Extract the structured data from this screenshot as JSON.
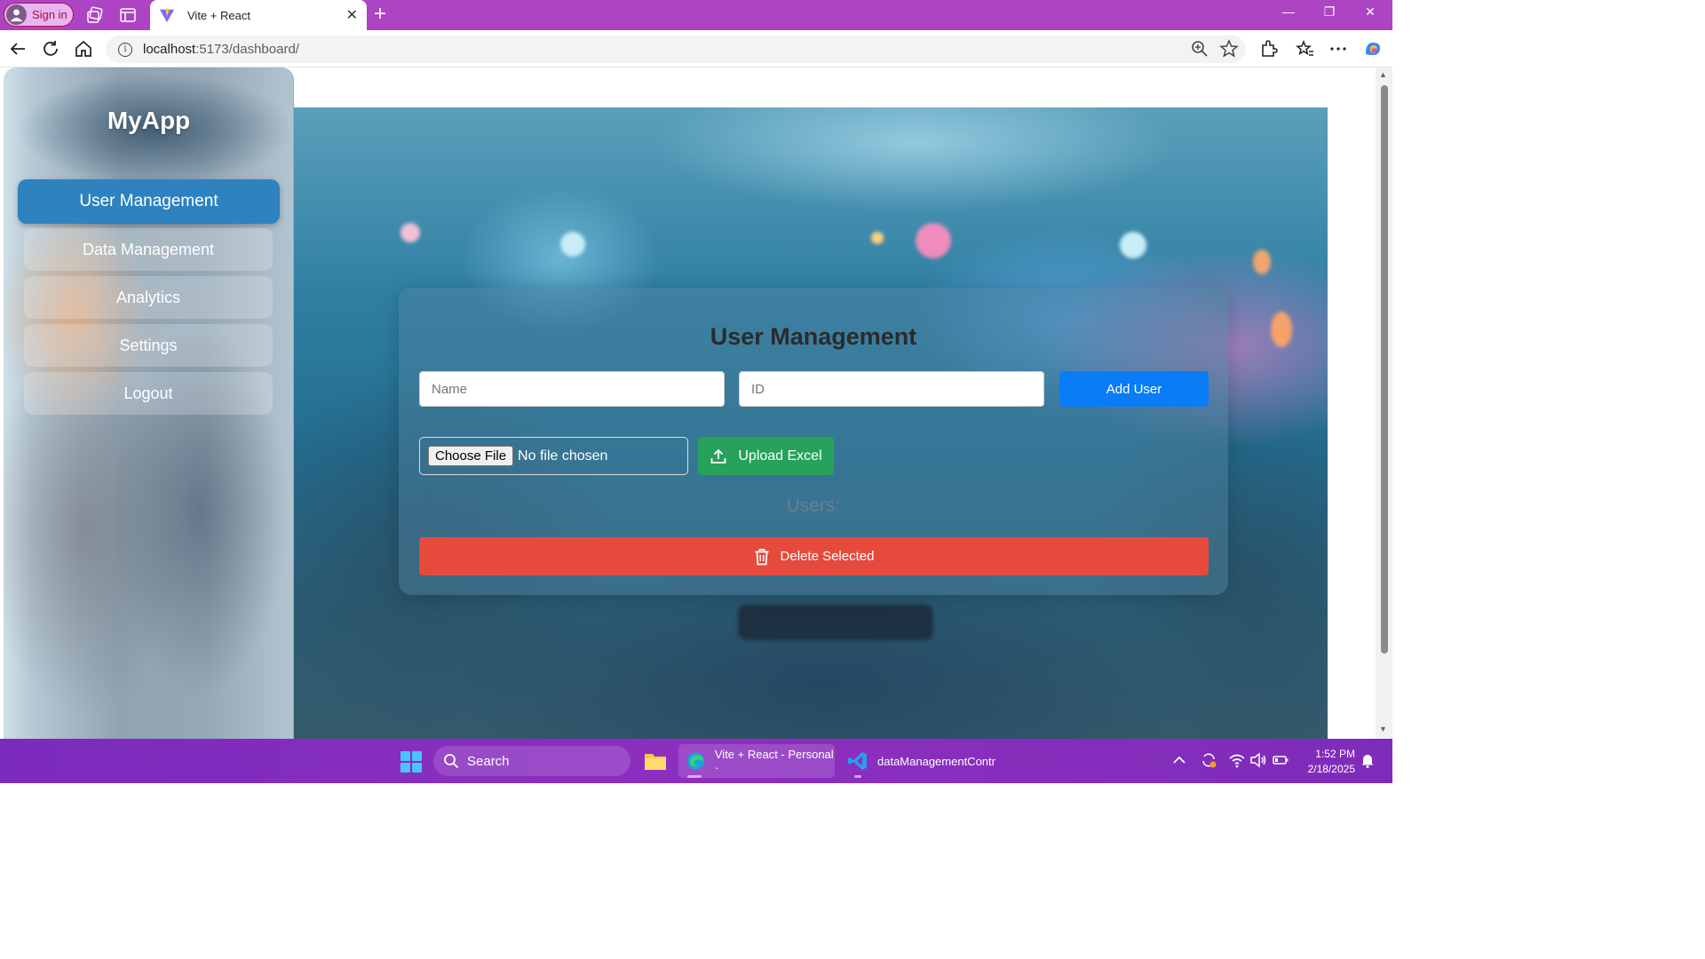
{
  "browser": {
    "signin_label": "Sign in",
    "tab_title": "Vite + React",
    "new_tab": "+",
    "url_host": "localhost",
    "url_path": ":5173/dashboard/"
  },
  "sidebar": {
    "brand": "MyApp",
    "items": [
      {
        "label": "User Management",
        "active": true
      },
      {
        "label": "Data Management",
        "active": false
      },
      {
        "label": "Analytics",
        "active": false
      },
      {
        "label": "Settings",
        "active": false
      },
      {
        "label": "Logout",
        "active": false
      }
    ]
  },
  "main": {
    "title": "User Management",
    "name_placeholder": "Name",
    "id_placeholder": "ID",
    "add_button": "Add User",
    "choose_file": "Choose File",
    "no_file": "No file chosen",
    "upload_button": "Upload Excel",
    "users_label": "Users:",
    "delete_button": "Delete Selected"
  },
  "colors": {
    "tab_bar": "#ad44c4",
    "add_button": "#0a7cf5",
    "upload_button": "#26a25a",
    "delete_button": "#e64a3d",
    "active_nav": "#2d82bf"
  },
  "taskbar": {
    "search_label": "Search",
    "edge_app": "Vite + React - Personal ·",
    "vscode_app": "dataManagementContr",
    "time": "1:52 PM",
    "date": "2/18/2025"
  }
}
